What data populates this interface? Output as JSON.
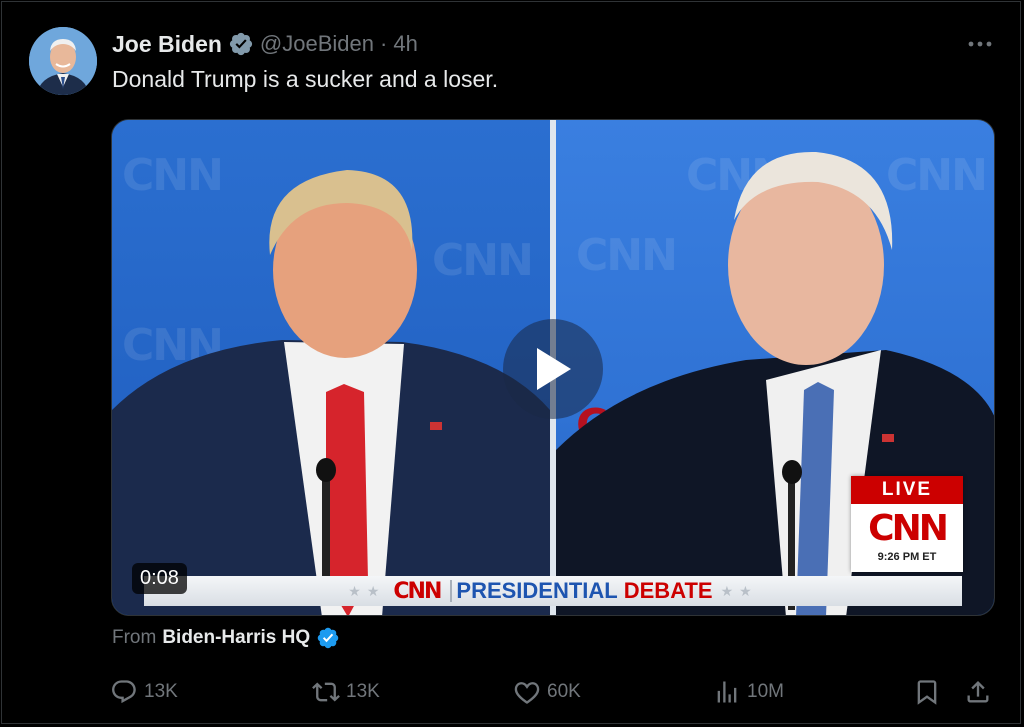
{
  "tweet": {
    "author_name": "Joe Biden",
    "handle": "@JoeBiden",
    "separator": "·",
    "time": "4h",
    "text": "Donald Trump is a sucker and a loser."
  },
  "video": {
    "duration": "0:08",
    "lower_third": {
      "network": "CNN",
      "title_part1": "PRESIDENTIAL",
      "title_part2": "DEBATE"
    },
    "live_bug": {
      "live_label": "LIVE",
      "network": "CNN",
      "time": "9:26 PM ET"
    },
    "background_logo": "CNN"
  },
  "source": {
    "prefix": "From",
    "name": "Biden-Harris HQ"
  },
  "actions": {
    "replies": "13K",
    "reposts": "13K",
    "likes": "60K",
    "views": "10M"
  },
  "icons": [
    "verified-badge-icon",
    "more-icon",
    "play-icon",
    "reply-icon",
    "repost-icon",
    "like-icon",
    "views-icon",
    "bookmark-icon",
    "share-icon"
  ],
  "colors": {
    "background": "#000000",
    "text_primary": "#e7e9ea",
    "text_secondary": "#71767b",
    "verified_blue": "#1d9bf0",
    "cnn_red": "#cc0000"
  }
}
